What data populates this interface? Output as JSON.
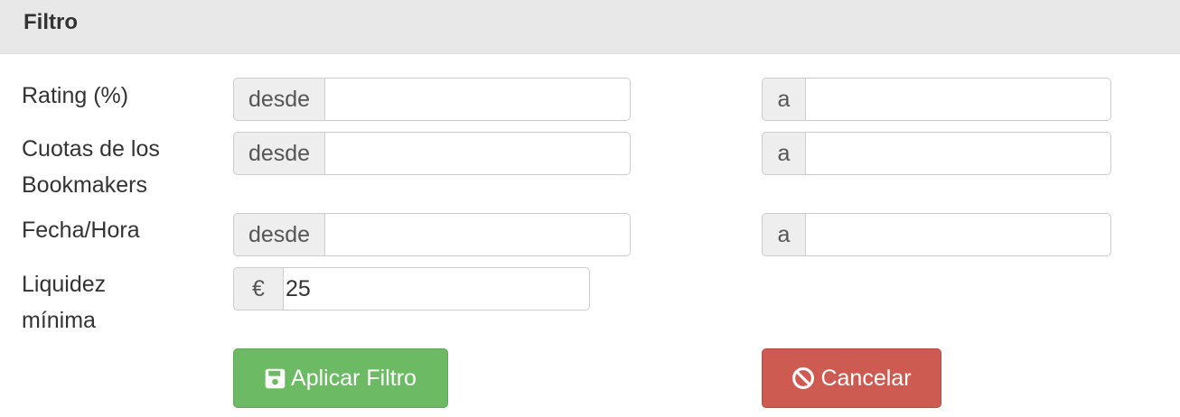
{
  "panel": {
    "title": "Filtro"
  },
  "rows": [
    {
      "label": "Rating (%)",
      "from_addon": "desde",
      "from_value": "",
      "to_addon": "a",
      "to_value": ""
    },
    {
      "label": "Cuotas de los Bookmakers",
      "label_line1": "Cuotas de los",
      "label_line2": "Bookmakers",
      "from_addon": "desde",
      "from_value": "",
      "to_addon": "a",
      "to_value": ""
    },
    {
      "label": "Fecha/Hora",
      "from_addon": "desde",
      "from_value": "",
      "to_addon": "a",
      "to_value": ""
    }
  ],
  "liquidity": {
    "label_line1": "Liquidez",
    "label_line2": "mínima",
    "addon": "€",
    "value": "25"
  },
  "buttons": {
    "apply": {
      "label": "Aplicar Filtro",
      "icon": "save-icon",
      "color": "#6cba64"
    },
    "cancel": {
      "label": "Cancelar",
      "icon": "ban-icon",
      "color": "#cd5b52"
    }
  }
}
